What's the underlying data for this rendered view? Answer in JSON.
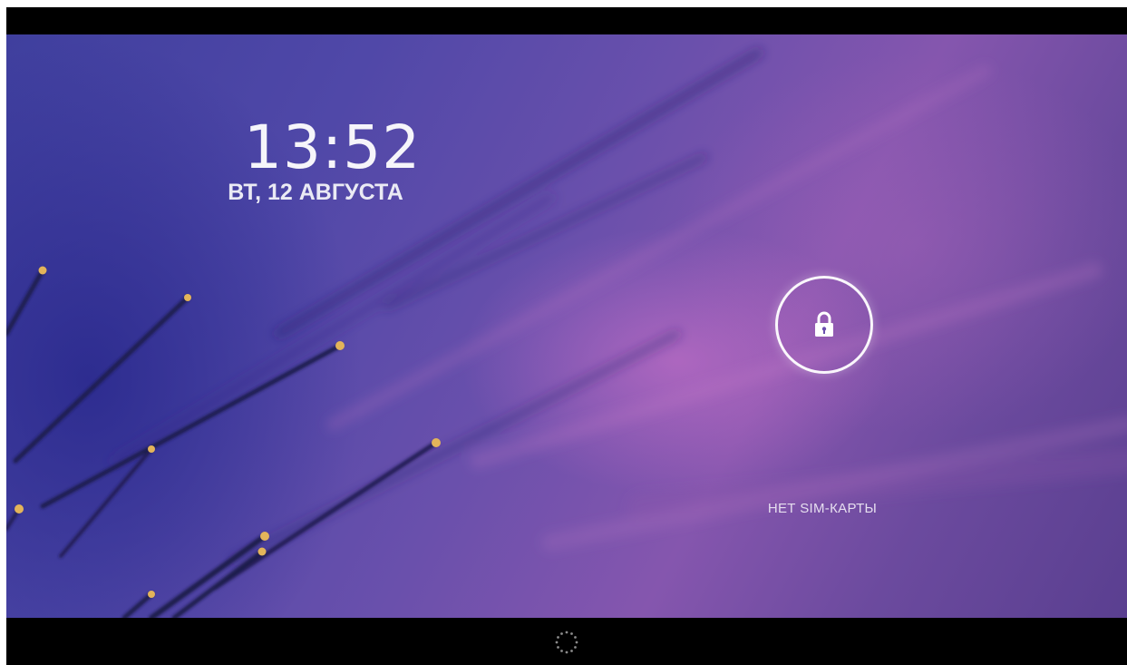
{
  "status_bar": {
    "icons": [
      "volume-icon",
      "wifi-icon",
      "battery-icon"
    ]
  },
  "lockscreen": {
    "time": "13:52",
    "date": "ВТ, 12 АВГУСТА",
    "carrier_text": "НЕТ SIM-КАРТЫ",
    "unlock_icon": "lock-icon"
  },
  "nav_bar": {
    "icon": "loading-spinner-icon"
  },
  "colors": {
    "background": "#000000",
    "wallpaper_primary": "#5048a8",
    "wallpaper_accent": "#d676ce",
    "text": "#ffffff"
  }
}
